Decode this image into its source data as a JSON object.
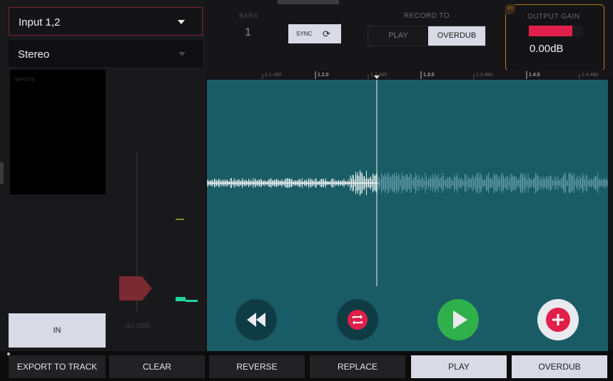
{
  "colors": {
    "accent_red": "#e0204a",
    "accent_green": "#2fb04b",
    "meter_green": "#21d4a4",
    "waveform_bg": "#1a5c65",
    "gain_border": "#b07a20",
    "button_light": "#d8dbe6"
  },
  "left_panel": {
    "input_select": {
      "value": "Input 1,2",
      "icon": "chevron-down-icon"
    },
    "mode_select": {
      "value": "Stereo",
      "icon": "chevron-down-icon"
    },
    "inputs_box": {
      "label": "INPUTS"
    },
    "fader": {
      "value_label": "-40.0dB"
    },
    "in_button": {
      "label": "IN"
    }
  },
  "top_bar": {
    "bars": {
      "label": "BARS",
      "value": "1"
    },
    "sync_button": {
      "label": "SYNC",
      "icon": "sync-icon"
    },
    "record_to": {
      "label": "RECORD TO",
      "options": [
        "PLAY",
        "OVERDUB"
      ],
      "selected": "OVERDUB"
    },
    "output_gain": {
      "label": "OUTPUT GAIN",
      "value": "0.00dB",
      "corner_badge": "On",
      "level": 0.8
    }
  },
  "ruler": {
    "marks": [
      "1.1.480",
      "1.2.0",
      "1.2.480",
      "1.3.0",
      "1.3.480",
      "1.4.0",
      "1.4.480"
    ]
  },
  "transport": {
    "rewind_icon": "rewind-icon",
    "loop_icon": "loop-icon",
    "play_icon": "play-icon",
    "add_icon": "plus-icon"
  },
  "bottom_bar": {
    "buttons": [
      "EXPORT TO TRACK",
      "CLEAR",
      "REVERSE",
      "REPLACE",
      "PLAY",
      "OVERDUB"
    ]
  }
}
